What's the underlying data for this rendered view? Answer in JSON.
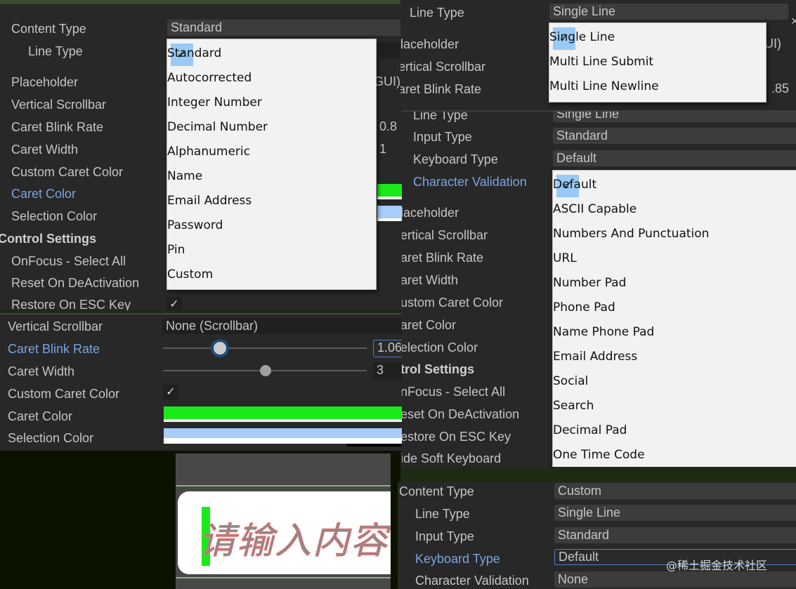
{
  "panel_content_type": {
    "labels": [
      "Content Type",
      "Line Type",
      "Placeholder",
      "Vertical Scrollbar",
      "Caret Blink Rate",
      "Caret Width",
      "Custom Caret Color",
      "Caret Color",
      "Selection Color",
      "Control Settings",
      "OnFocus - Select All",
      "Reset On DeActivation",
      "Restore On ESC Key"
    ],
    "field_value": "Standard",
    "behind_values": [
      "GUI)",
      "0.8",
      "1"
    ],
    "menu": {
      "selected": "Standard",
      "items": [
        "Standard",
        "Autocorrected",
        "Integer Number",
        "Decimal Number",
        "Alphanumeric",
        "Name",
        "Email Address",
        "Password",
        "Pin",
        "Custom"
      ]
    }
  },
  "panel_line_type": {
    "labels": [
      "Line Type",
      "laceholder",
      "ertical Scrollbar",
      "aret Blink Rate"
    ],
    "field_value": "Single Line",
    "behind_values": [
      "UI)",
      ".85"
    ],
    "menu": {
      "selected": "Single Line",
      "items": [
        "Single Line",
        "Multi Line Submit",
        "Multi Line Newline"
      ]
    }
  },
  "panel_validation": {
    "labels": [
      "Line Type",
      "Input Type",
      "Keyboard Type",
      "Character Validation",
      "laceholder",
      "ertical Scrollbar",
      "aret Blink Rate",
      "aret Width",
      "ustom Caret Color",
      "aret Color",
      "election Color",
      "trol Settings",
      "nFocus - Select All",
      "eset On DeActivation",
      "estore On ESC Key",
      "ide Soft Keyboard"
    ],
    "fields": [
      "Single Line",
      "Standard",
      "Default"
    ],
    "menu": {
      "selected": "Default",
      "items": [
        "Default",
        "ASCII Capable",
        "Numbers And Punctuation",
        "URL",
        "Number Pad",
        "Phone Pad",
        "Name Phone Pad",
        "Email Address",
        "Social",
        "Search",
        "Decimal Pad",
        "One Time Code"
      ]
    }
  },
  "panel_caret": {
    "labels": [
      "Vertical Scrollbar",
      "Caret Blink Rate",
      "Caret Width",
      "Custom Caret Color",
      "Caret Color",
      "Selection Color"
    ],
    "vertical_scrollbar": "None (Scrollbar)",
    "caret_blink_rate": "1.06",
    "caret_width": "3",
    "custom_caret_color": true,
    "caret_color": "#1aea1a",
    "selection_color": "#a8cdfa"
  },
  "game_view": {
    "placeholder": "请输入内容",
    "caret_color": "#1aea1a"
  },
  "panel_keyboard": {
    "labels": [
      "Content Type",
      "Line Type",
      "Input Type",
      "Keyboard Type",
      "Character Validation"
    ],
    "fields": [
      "Custom",
      "Single Line",
      "Standard",
      "Default",
      "None"
    ]
  },
  "watermark": "@稀土掘金技术社区",
  "colors": {
    "panel_bg": "#282828",
    "highlight_label": "#7ba4e0",
    "menu_check_bg": "#99c9f5",
    "menu_bg": "#f2f2f2"
  }
}
